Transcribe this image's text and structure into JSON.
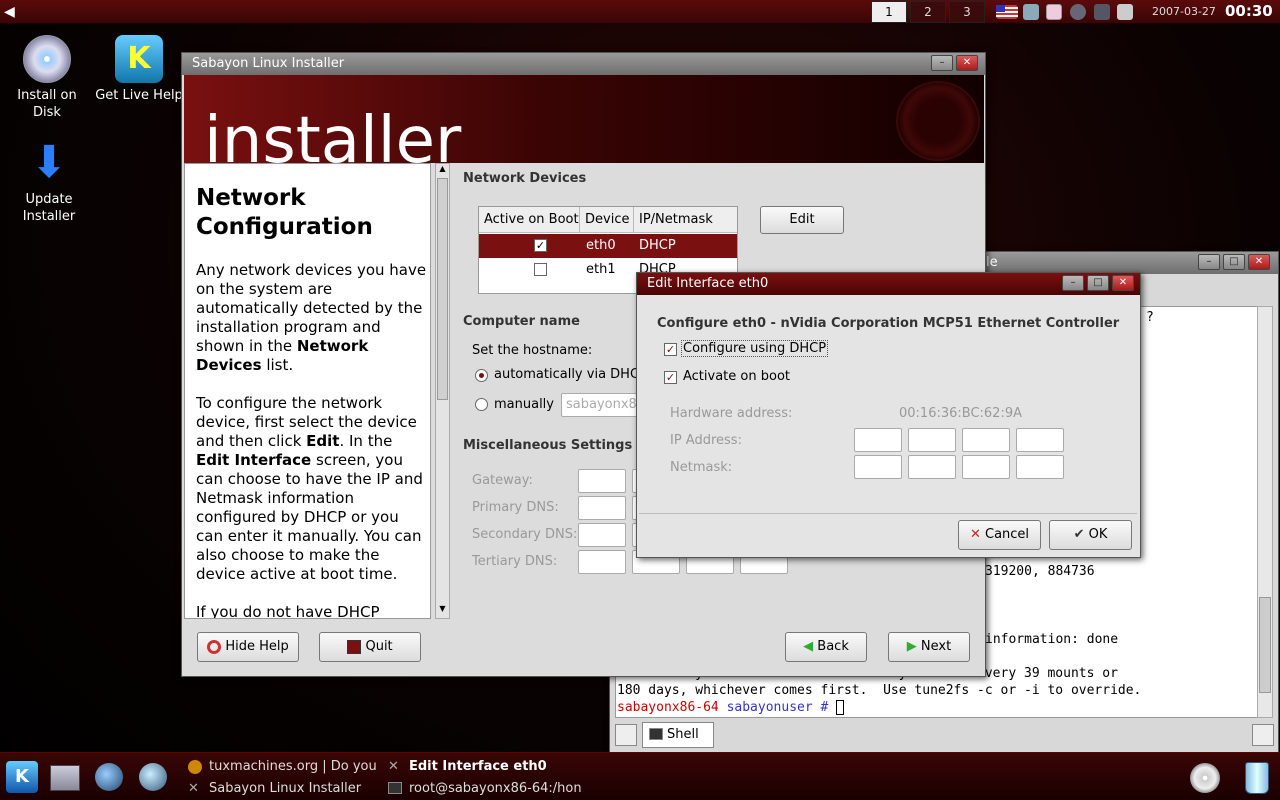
{
  "top_panel": {
    "pagers": [
      "1",
      "2",
      "3"
    ],
    "date": "2007-03-27",
    "time": "00:30"
  },
  "desktop": {
    "icons": [
      {
        "label": "Install on Disk"
      },
      {
        "label": "Get Live Help"
      },
      {
        "label": "Update Installer"
      }
    ]
  },
  "installer": {
    "window_title": "Sabayon Linux Installer",
    "banner_text": "installer",
    "help": {
      "title": "Network Configuration",
      "p1_a": "Any network devices you have on the system are automatically detected by the installation program and shown in the ",
      "p1_b": "Network Devices",
      "p1_c": " list.",
      "p2_a": "To configure the network device, first select the device and then click ",
      "p2_b": "Edit",
      "p2_c": ". In the ",
      "p2_d": "Edit Interface",
      "p2_e": " screen, you can choose to have the IP and Netmask information configured by DHCP or you can enter it manually. You can also choose to make the device active at boot time.",
      "p3": "If you do not have DHCP"
    },
    "network_devices_title": "Network Devices",
    "table": {
      "headers": [
        "Active on Boot",
        "Device",
        "IP/Netmask"
      ],
      "rows": [
        {
          "active": true,
          "device": "eth0",
          "ip": "DHCP"
        },
        {
          "active": false,
          "device": "eth1",
          "ip": "DHCP"
        }
      ]
    },
    "edit_label": "Edit",
    "computer_name_title": "Computer name",
    "set_hostname": "Set the hostname:",
    "auto_option": "automatically via DHCP",
    "manual_option": "manually",
    "hostname_placeholder": "sabayonx86",
    "misc_title": "Miscellaneous Settings",
    "misc_fields": [
      "Gateway:",
      "Primary DNS:",
      "Secondary DNS:",
      "Tertiary DNS:"
    ],
    "buttons": {
      "hide_help": "Hide Help",
      "quit": "Quit",
      "back": "Back",
      "next": "Next"
    }
  },
  "dialog": {
    "title": "Edit Interface eth0",
    "heading": "Configure eth0 - nVidia Corporation MCP51 Ethernet Controller",
    "dhcp_label": "Configure using DHCP",
    "boot_label": "Activate on boot",
    "hw_label": "Hardware address:",
    "hw_value": "00:16:36:BC:62:9A",
    "ip_label": "IP Address:",
    "netmask_label": "Netmask:",
    "cancel": "Cancel",
    "ok": "OK"
  },
  "terminal": {
    "title_fragment": "le",
    "question_mark": "?",
    "line_numbers": "319200, 884736",
    "line_done": "information: done",
    "line_a": "This filesystem will be automatically checked every 39 mounts or",
    "line_b": "180 days, whichever comes first.  Use tune2fs -c or -i to override.",
    "prompt_host": "sabayonx86-64",
    "prompt_user": "sabayonuser",
    "prompt_sym": "#",
    "tab_label": "Shell"
  },
  "taskbar": {
    "tasks": [
      "tuxmachines.org | Do you",
      "Edit Interface eth0",
      "Sabayon Linux Installer",
      "root@sabayonx86-64:/hon"
    ]
  },
  "colors": {
    "accent": "#7a1010",
    "selection": "#7a1010"
  }
}
